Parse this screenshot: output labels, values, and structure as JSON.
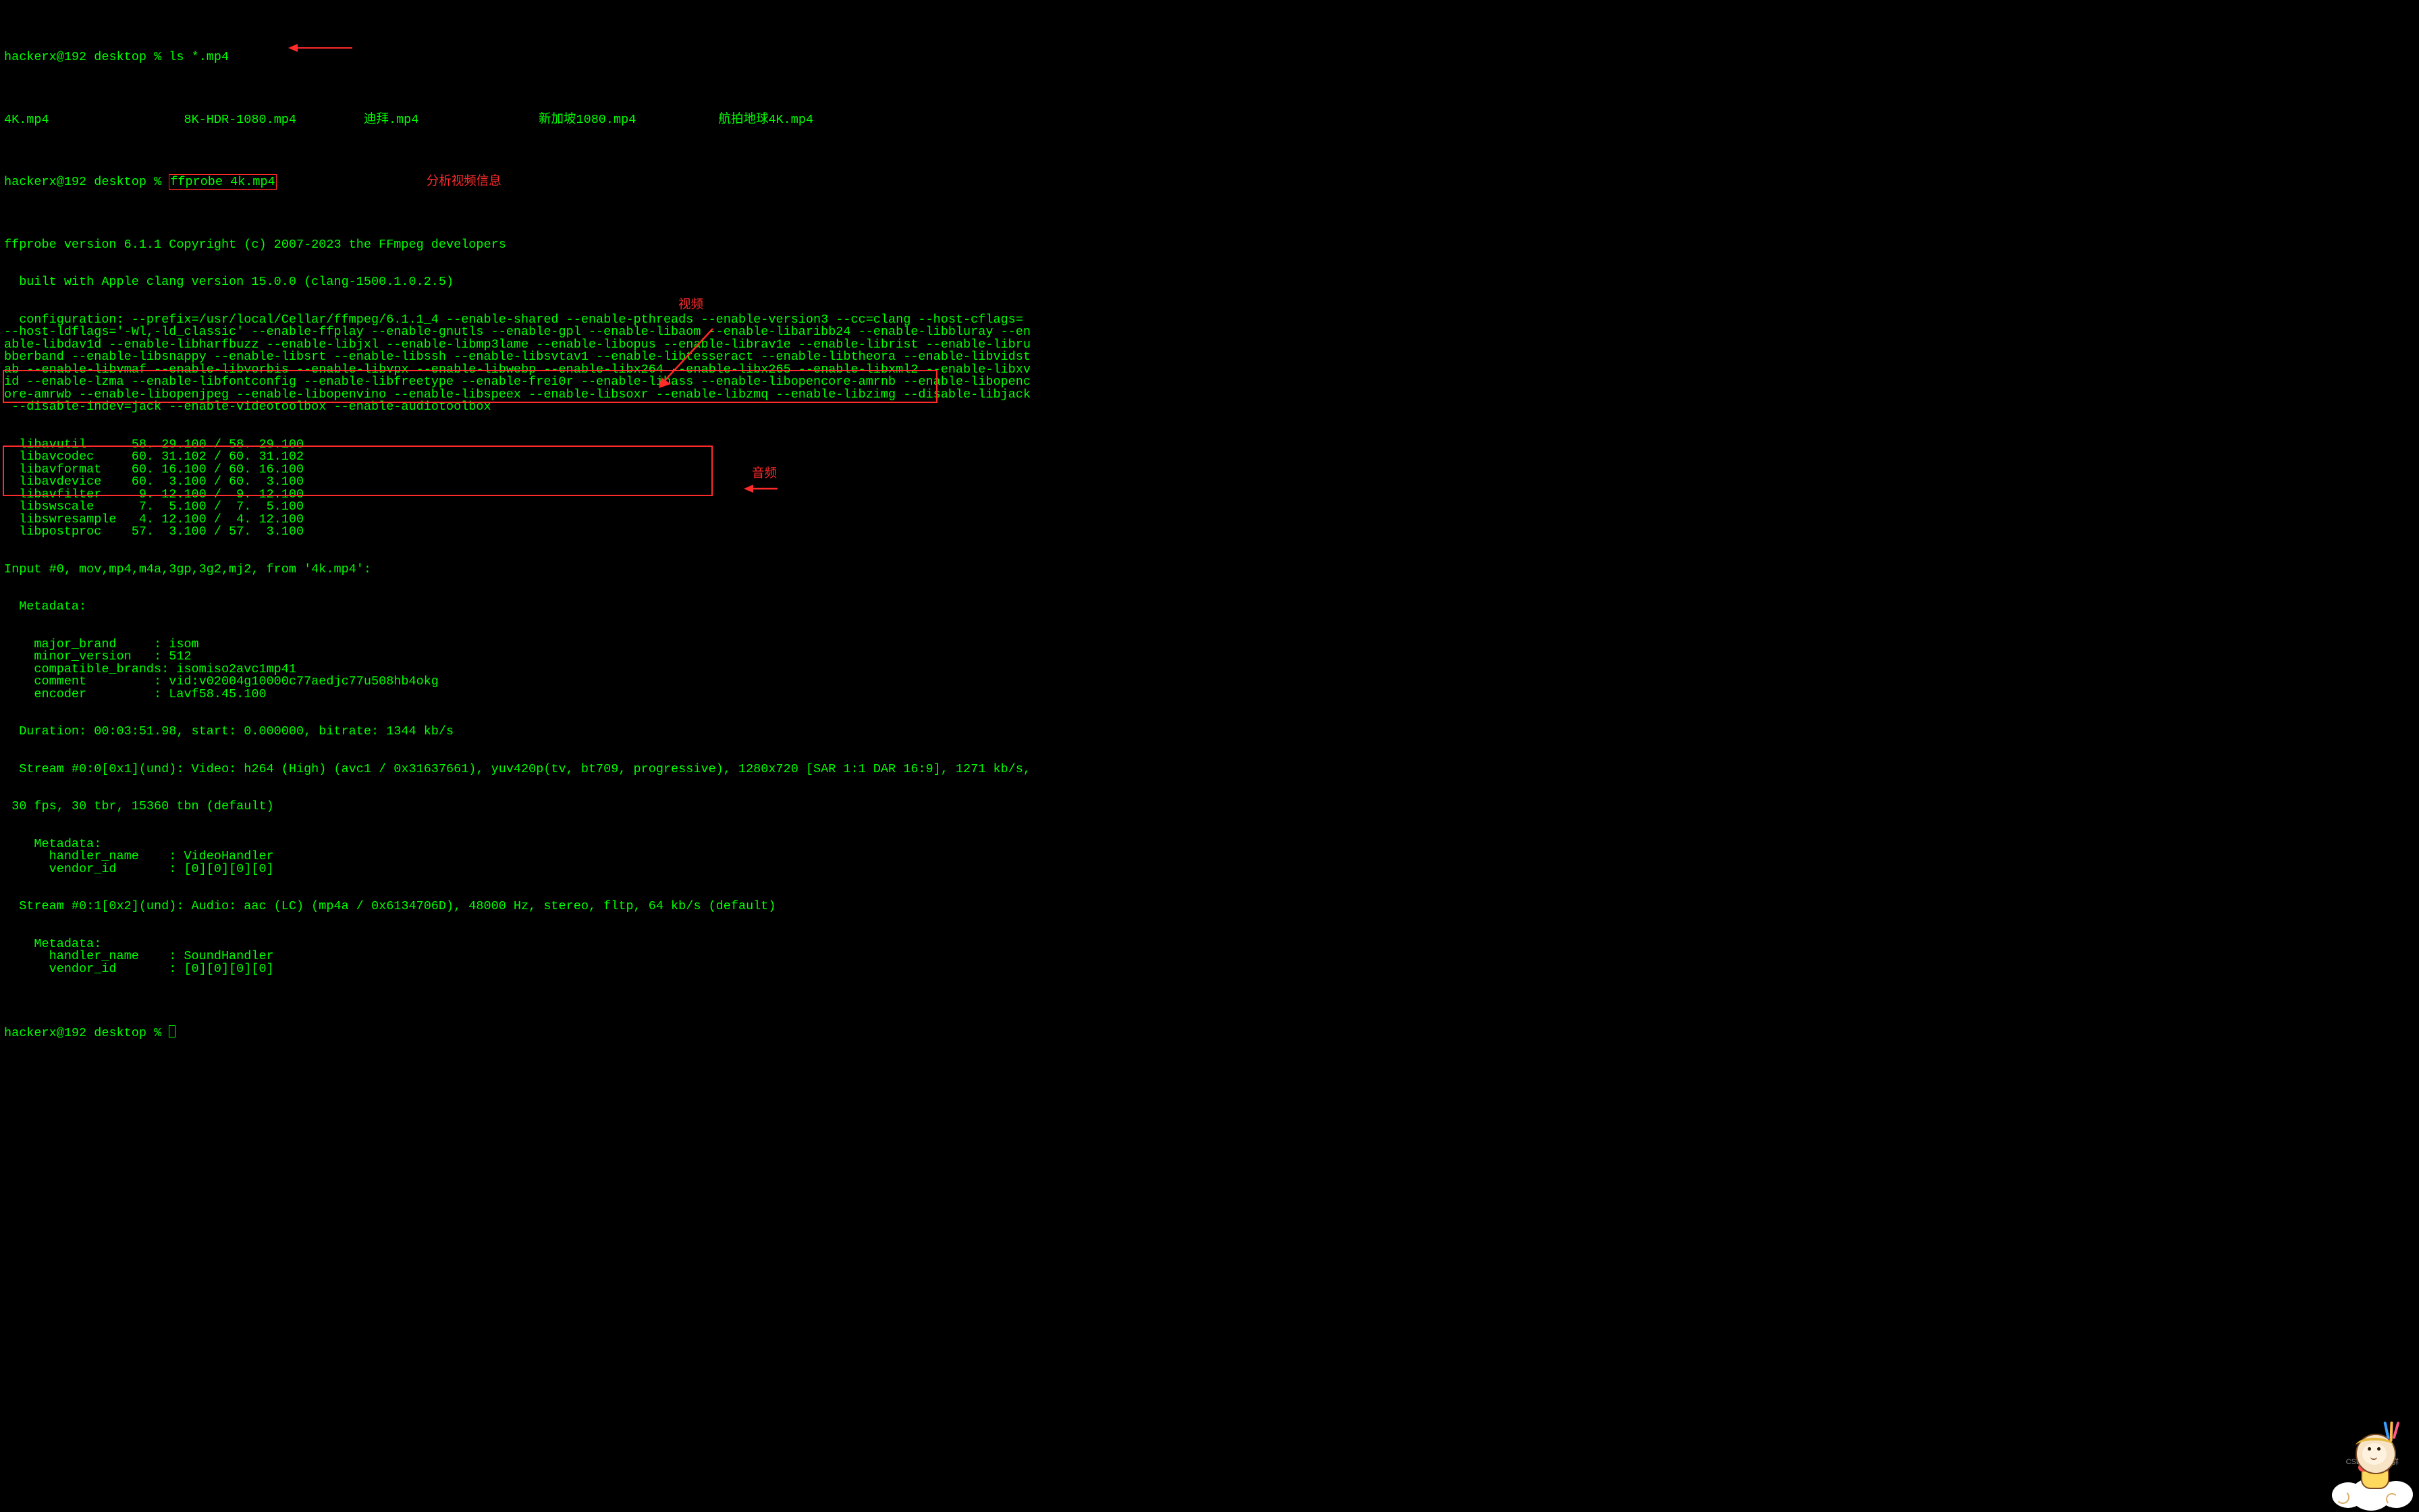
{
  "colors": {
    "fg": "#00ff00",
    "bg": "#000000",
    "annotation": "#ff2a2a"
  },
  "watermark": "CSDN @林鸿群",
  "prompt": {
    "user_host": "hackerx@192",
    "dir": "desktop",
    "symbol": "%"
  },
  "commands": {
    "ls": "ls *.mp4",
    "ffprobe": "ffprobe 4k.mp4"
  },
  "ls_output": {
    "col1": "4K.mp4",
    "col2": "8K-HDR-1080.mp4",
    "col3": "迪拜.mp4",
    "col4": "新加坡1080.mp4",
    "col5": "航拍地球4K.mp4"
  },
  "annotations": {
    "analyze": "分析视频信息",
    "video": "视频",
    "audio": "音频"
  },
  "ffprobe": {
    "version_line": "ffprobe version 6.1.1 Copyright (c) 2007-2023 the FFmpeg developers",
    "built_line": "  built with Apple clang version 15.0.0 (clang-1500.1.0.2.5)",
    "config_block": "  configuration: --prefix=/usr/local/Cellar/ffmpeg/6.1.1_4 --enable-shared --enable-pthreads --enable-version3 --cc=clang --host-cflags=\n--host-ldflags='-Wl,-ld_classic' --enable-ffplay --enable-gnutls --enable-gpl --enable-libaom --enable-libaribb24 --enable-libbluray --en\nable-libdav1d --enable-libharfbuzz --enable-libjxl --enable-libmp3lame --enable-libopus --enable-librav1e --enable-librist --enable-libru\nbberband --enable-libsnappy --enable-libsrt --enable-libssh --enable-libsvtav1 --enable-libtesseract --enable-libtheora --enable-libvidst\nab --enable-libvmaf --enable-libvorbis --enable-libvpx --enable-libwebp --enable-libx264 --enable-libx265 --enable-libxml2 --enable-libxv\nid --enable-lzma --enable-libfontconfig --enable-libfreetype --enable-frei0r --enable-libass --enable-libopencore-amrnb --enable-libopenc\nore-amrwb --enable-libopenjpeg --enable-libopenvino --enable-libspeex --enable-libsoxr --enable-libzmq --enable-libzimg --disable-libjack\n --disable-indev=jack --enable-videotoolbox --enable-audiotoolbox",
    "libs_block": "  libavutil      58. 29.100 / 58. 29.100\n  libavcodec     60. 31.102 / 60. 31.102\n  libavformat    60. 16.100 / 60. 16.100\n  libavdevice    60.  3.100 / 60.  3.100\n  libavfilter     9. 12.100 /  9. 12.100\n  libswscale      7.  5.100 /  7.  5.100\n  libswresample   4. 12.100 /  4. 12.100\n  libpostproc    57.  3.100 / 57.  3.100",
    "input_line": "Input #0, mov,mp4,m4a,3gp,3g2,mj2, from '4k.mp4':",
    "metadata_hdr": "  Metadata:",
    "meta_block": "    major_brand     : isom\n    minor_version   : 512\n    compatible_brands: isomiso2avc1mp41\n    comment         : vid:v02004g10000c77aedjc77u508hb4okg\n    encoder         : Lavf58.45.100",
    "duration_line": "  Duration: 00:03:51.98, start: 0.000000, bitrate: 1344 kb/s",
    "video_stream_line1": "  Stream #0:0[0x1](und): Video: h264 (High) (avc1 / 0x31637661), yuv420p(tv, bt709, progressive), 1280x720 [SAR 1:1 DAR 16:9], 1271 kb/s,",
    "video_stream_line2": " 30 fps, 30 tbr, 15360 tbn (default)",
    "video_meta_block": "    Metadata:\n      handler_name    : VideoHandler\n      vendor_id       : [0][0][0][0]",
    "audio_stream_line": "  Stream #0:1[0x2](und): Audio: aac (LC) (mp4a / 0x6134706D), 48000 Hz, stereo, fltp, 64 kb/s (default)",
    "audio_meta_block": "    Metadata:\n      handler_name    : SoundHandler\n      vendor_id       : [0][0][0][0]"
  }
}
